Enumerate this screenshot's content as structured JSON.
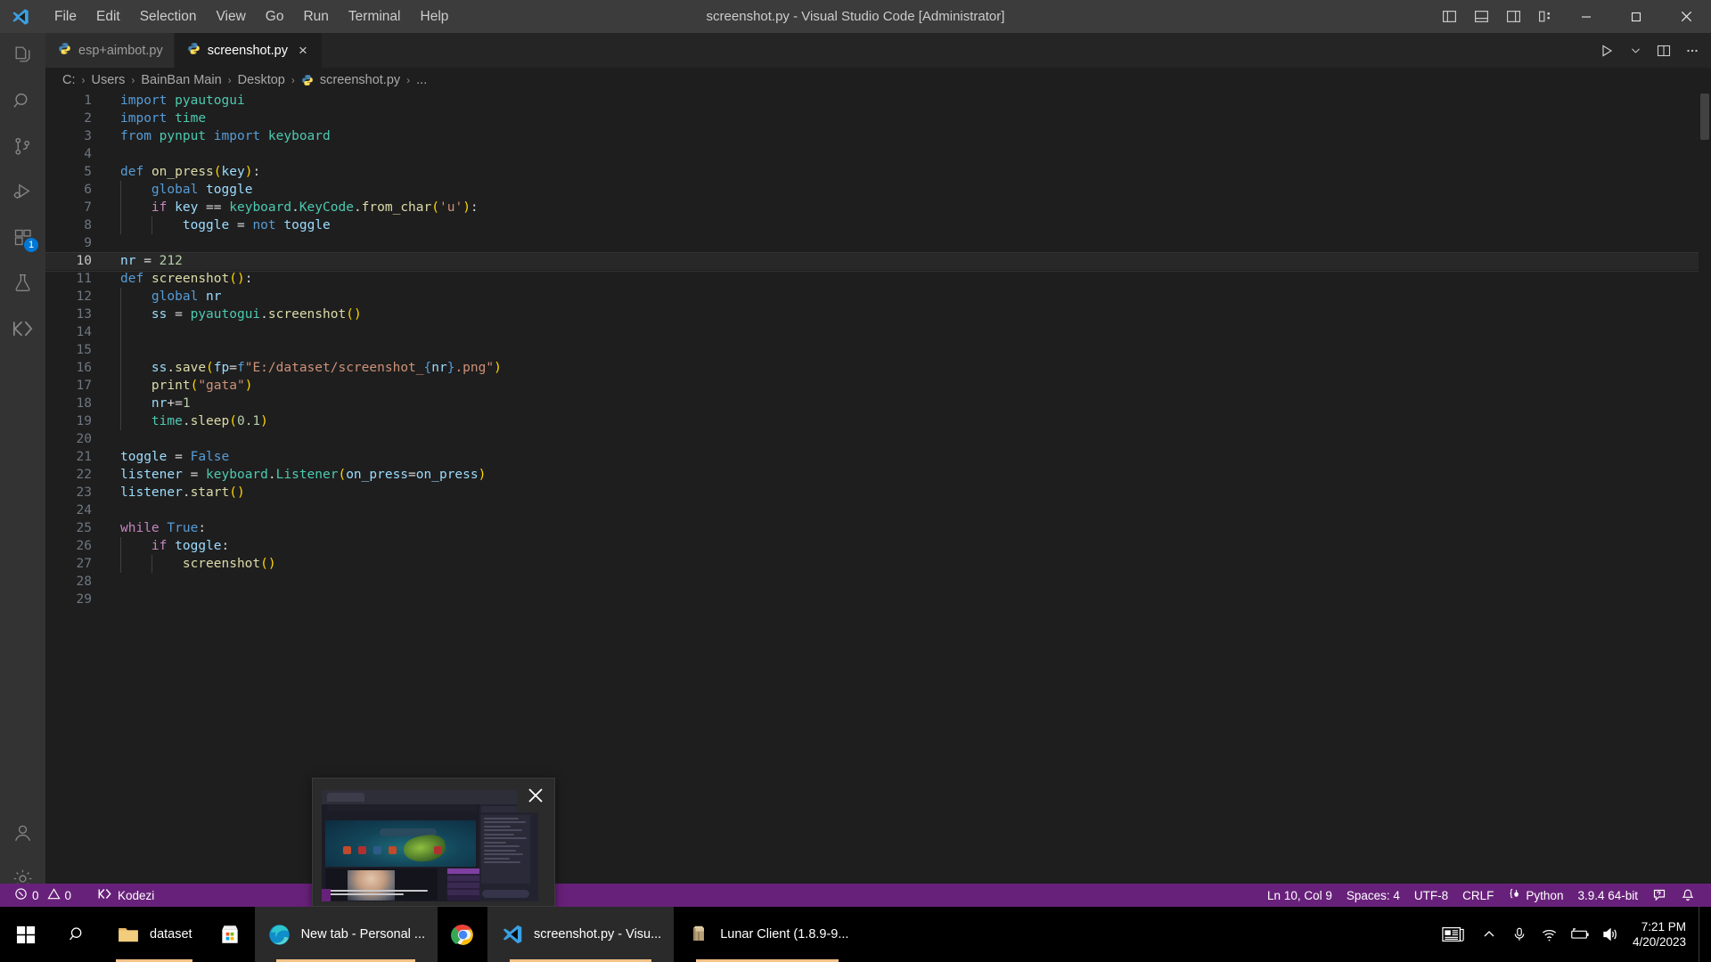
{
  "titlebar": {
    "window_title": "screenshot.py - Visual Studio Code [Administrator]",
    "logo": "vscode-logo",
    "menu": [
      "File",
      "Edit",
      "Selection",
      "View",
      "Go",
      "Run",
      "Terminal",
      "Help"
    ],
    "layout_buttons": [
      "toggle-primary-sidebar",
      "toggle-panel",
      "toggle-secondary-sidebar",
      "customize-layout"
    ],
    "window_controls": [
      "minimize",
      "maximize",
      "close"
    ]
  },
  "activitybar": {
    "items": [
      {
        "name": "explorer",
        "icon": "files-icon",
        "active": false
      },
      {
        "name": "search",
        "icon": "search-icon",
        "active": false
      },
      {
        "name": "source-control",
        "icon": "source-control-icon",
        "active": false
      },
      {
        "name": "run-and-debug",
        "icon": "run-debug-icon",
        "active": false
      },
      {
        "name": "extensions",
        "icon": "extensions-icon",
        "active": false,
        "badge": "1"
      },
      {
        "name": "testing",
        "icon": "beaker-icon",
        "active": false
      },
      {
        "name": "kodezi",
        "icon": "kodezi-icon",
        "active": false
      }
    ],
    "bottom": [
      {
        "name": "accounts",
        "icon": "account-icon"
      },
      {
        "name": "manage",
        "icon": "gear-icon"
      }
    ]
  },
  "tabs": [
    {
      "label": "esp+aimbot.py",
      "icon": "python-icon",
      "active": false,
      "closable": false
    },
    {
      "label": "screenshot.py",
      "icon": "python-icon",
      "active": true,
      "closable": true,
      "close_glyph": "×"
    }
  ],
  "tab_actions": [
    "run-python-file",
    "run-chevron",
    "split-editor",
    "more-actions"
  ],
  "breadcrumb": {
    "segments": [
      "C:",
      "Users",
      "BainBan Main",
      "Desktop",
      "screenshot.py",
      "..."
    ],
    "separator": "›",
    "file_icon": "python-icon"
  },
  "editor": {
    "language": "python",
    "lines": [
      {
        "n": 1,
        "tokens": [
          [
            "t-kw",
            "import"
          ],
          [
            "t-plain",
            " "
          ],
          [
            "t-cls",
            "pyautogui"
          ]
        ]
      },
      {
        "n": 2,
        "tokens": [
          [
            "t-kw",
            "import"
          ],
          [
            "t-plain",
            " "
          ],
          [
            "t-cls",
            "time"
          ]
        ]
      },
      {
        "n": 3,
        "tokens": [
          [
            "t-kw",
            "from"
          ],
          [
            "t-plain",
            " "
          ],
          [
            "t-cls",
            "pynput"
          ],
          [
            "t-plain",
            " "
          ],
          [
            "t-kw",
            "import"
          ],
          [
            "t-plain",
            " "
          ],
          [
            "t-cls",
            "keyboard"
          ]
        ]
      },
      {
        "n": 4,
        "tokens": []
      },
      {
        "n": 5,
        "tokens": [
          [
            "t-kw",
            "def"
          ],
          [
            "t-plain",
            " "
          ],
          [
            "t-fn",
            "on_press"
          ],
          [
            "t-paren",
            "("
          ],
          [
            "t-var",
            "key"
          ],
          [
            "t-paren",
            ")"
          ],
          [
            "t-plain",
            ":"
          ]
        ]
      },
      {
        "n": 6,
        "tokens": [
          [
            "t-plain",
            "    "
          ],
          [
            "t-kw",
            "global"
          ],
          [
            "t-plain",
            " "
          ],
          [
            "t-var",
            "toggle"
          ]
        ],
        "guides": [
          1
        ]
      },
      {
        "n": 7,
        "tokens": [
          [
            "t-plain",
            "    "
          ],
          [
            "t-kw2",
            "if"
          ],
          [
            "t-plain",
            " "
          ],
          [
            "t-var",
            "key"
          ],
          [
            "t-plain",
            " == "
          ],
          [
            "t-cls",
            "keyboard"
          ],
          [
            "t-plain",
            "."
          ],
          [
            "t-cls",
            "KeyCode"
          ],
          [
            "t-plain",
            "."
          ],
          [
            "t-fn",
            "from_char"
          ],
          [
            "t-paren",
            "("
          ],
          [
            "t-str",
            "'u'"
          ],
          [
            "t-paren",
            ")"
          ],
          [
            "t-plain",
            ":"
          ]
        ],
        "guides": [
          1
        ]
      },
      {
        "n": 8,
        "tokens": [
          [
            "t-plain",
            "        "
          ],
          [
            "t-var",
            "toggle"
          ],
          [
            "t-plain",
            " = "
          ],
          [
            "t-kw",
            "not"
          ],
          [
            "t-plain",
            " "
          ],
          [
            "t-var",
            "toggle"
          ]
        ],
        "guides": [
          1,
          2
        ]
      },
      {
        "n": 9,
        "tokens": []
      },
      {
        "n": 10,
        "tokens": [
          [
            "t-var",
            "nr"
          ],
          [
            "t-plain",
            " = "
          ],
          [
            "t-num",
            "212"
          ]
        ],
        "current": true
      },
      {
        "n": 11,
        "tokens": [
          [
            "t-kw",
            "def"
          ],
          [
            "t-plain",
            " "
          ],
          [
            "t-fn",
            "screenshot"
          ],
          [
            "t-paren",
            "("
          ],
          [
            "t-paren",
            ")"
          ],
          [
            "t-plain",
            ":"
          ]
        ]
      },
      {
        "n": 12,
        "tokens": [
          [
            "t-plain",
            "    "
          ],
          [
            "t-kw",
            "global"
          ],
          [
            "t-plain",
            " "
          ],
          [
            "t-var",
            "nr"
          ]
        ],
        "guides": [
          1
        ]
      },
      {
        "n": 13,
        "tokens": [
          [
            "t-plain",
            "    "
          ],
          [
            "t-var",
            "ss"
          ],
          [
            "t-plain",
            " = "
          ],
          [
            "t-cls",
            "pyautogui"
          ],
          [
            "t-plain",
            "."
          ],
          [
            "t-fn",
            "screenshot"
          ],
          [
            "t-paren",
            "("
          ],
          [
            "t-paren",
            ")"
          ]
        ],
        "guides": [
          1
        ]
      },
      {
        "n": 14,
        "tokens": [],
        "guides": [
          1
        ]
      },
      {
        "n": 15,
        "tokens": [],
        "guides": [
          1
        ]
      },
      {
        "n": 16,
        "tokens": [
          [
            "t-plain",
            "    "
          ],
          [
            "t-var",
            "ss"
          ],
          [
            "t-plain",
            "."
          ],
          [
            "t-fn",
            "save"
          ],
          [
            "t-paren",
            "("
          ],
          [
            "t-var",
            "fp"
          ],
          [
            "t-plain",
            "="
          ],
          [
            "t-fstr",
            "f"
          ],
          [
            "t-str",
            "\"E:/dataset/screenshot_"
          ],
          [
            "t-brace",
            "{"
          ],
          [
            "t-var",
            "nr"
          ],
          [
            "t-brace",
            "}"
          ],
          [
            "t-str",
            ".png\""
          ],
          [
            "t-paren",
            ")"
          ]
        ],
        "guides": [
          1
        ]
      },
      {
        "n": 17,
        "tokens": [
          [
            "t-plain",
            "    "
          ],
          [
            "t-fn",
            "print"
          ],
          [
            "t-paren",
            "("
          ],
          [
            "t-str",
            "\"gata\""
          ],
          [
            "t-paren",
            ")"
          ]
        ],
        "guides": [
          1
        ]
      },
      {
        "n": 18,
        "tokens": [
          [
            "t-plain",
            "    "
          ],
          [
            "t-var",
            "nr"
          ],
          [
            "t-plain",
            "+="
          ],
          [
            "t-num",
            "1"
          ]
        ],
        "guides": [
          1
        ]
      },
      {
        "n": 19,
        "tokens": [
          [
            "t-plain",
            "    "
          ],
          [
            "t-cls",
            "time"
          ],
          [
            "t-plain",
            "."
          ],
          [
            "t-fn",
            "sleep"
          ],
          [
            "t-paren",
            "("
          ],
          [
            "t-num",
            "0.1"
          ],
          [
            "t-paren",
            ")"
          ]
        ],
        "guides": [
          1
        ]
      },
      {
        "n": 20,
        "tokens": []
      },
      {
        "n": 21,
        "tokens": [
          [
            "t-var",
            "toggle"
          ],
          [
            "t-plain",
            " = "
          ],
          [
            "t-kw",
            "False"
          ]
        ]
      },
      {
        "n": 22,
        "tokens": [
          [
            "t-var",
            "listener"
          ],
          [
            "t-plain",
            " = "
          ],
          [
            "t-cls",
            "keyboard"
          ],
          [
            "t-plain",
            "."
          ],
          [
            "t-cls",
            "Listener"
          ],
          [
            "t-paren",
            "("
          ],
          [
            "t-var",
            "on_press"
          ],
          [
            "t-plain",
            "="
          ],
          [
            "t-var",
            "on_press"
          ],
          [
            "t-paren",
            ")"
          ]
        ]
      },
      {
        "n": 23,
        "tokens": [
          [
            "t-var",
            "listener"
          ],
          [
            "t-plain",
            "."
          ],
          [
            "t-fn",
            "start"
          ],
          [
            "t-paren",
            "("
          ],
          [
            "t-paren",
            ")"
          ]
        ]
      },
      {
        "n": 24,
        "tokens": []
      },
      {
        "n": 25,
        "tokens": [
          [
            "t-kw2",
            "while"
          ],
          [
            "t-plain",
            " "
          ],
          [
            "t-kw",
            "True"
          ],
          [
            "t-plain",
            ":"
          ]
        ]
      },
      {
        "n": 26,
        "tokens": [
          [
            "t-plain",
            "    "
          ],
          [
            "t-kw2",
            "if"
          ],
          [
            "t-plain",
            " "
          ],
          [
            "t-var",
            "toggle"
          ],
          [
            "t-plain",
            ":"
          ]
        ],
        "guides": [
          1
        ]
      },
      {
        "n": 27,
        "tokens": [
          [
            "t-plain",
            "        "
          ],
          [
            "t-fn",
            "screenshot"
          ],
          [
            "t-paren",
            "("
          ],
          [
            "t-paren",
            ")"
          ]
        ],
        "guides": [
          1,
          2
        ]
      },
      {
        "n": 28,
        "tokens": []
      },
      {
        "n": 29,
        "tokens": []
      }
    ]
  },
  "statusbar": {
    "background": "#68217a",
    "left": [
      {
        "name": "problems",
        "icon": "error-icon",
        "errors": "0",
        "warn_icon": "warning-icon",
        "warnings": "0"
      },
      {
        "name": "kodezi",
        "icon": "kodezi-icon",
        "label": "Kodezi"
      }
    ],
    "right": [
      {
        "name": "cursor-position",
        "label": "Ln 10, Col 9"
      },
      {
        "name": "indentation",
        "label": "Spaces: 4"
      },
      {
        "name": "encoding",
        "label": "UTF-8"
      },
      {
        "name": "eol",
        "label": "CRLF"
      },
      {
        "name": "language-mode",
        "label": "Python",
        "icon": "python-brackets-icon"
      },
      {
        "name": "interpreter",
        "label": "3.9.4 64-bit"
      },
      {
        "name": "feedback",
        "icon": "feedback-icon"
      },
      {
        "name": "notifications",
        "icon": "bell-icon"
      }
    ]
  },
  "preview": {
    "name": "taskbar-thumbnail-preview",
    "close_glyph": "✕"
  },
  "taskbar": {
    "start": "windows-start-icon",
    "search": "search-icon",
    "apps": [
      {
        "label": "dataset",
        "icon": "folder-icon",
        "running": true,
        "active": false
      },
      {
        "label": "",
        "icon": "microsoft-store-icon",
        "running": false,
        "active": false
      },
      {
        "label": "New tab - Personal ...",
        "icon": "edge-icon",
        "running": true,
        "active": true
      },
      {
        "label": "",
        "icon": "chrome-icon",
        "running": false,
        "active": false
      },
      {
        "label": "screenshot.py - Visu...",
        "icon": "vscode-icon",
        "running": true,
        "active": true
      },
      {
        "label": "Lunar Client (1.8.9-9...",
        "icon": "lunar-client-icon",
        "running": true,
        "active": false
      }
    ],
    "tray": [
      {
        "name": "news-and-interests",
        "icon": "news-icon"
      },
      {
        "name": "show-hidden-icons",
        "icon": "chevron-up-icon"
      },
      {
        "name": "microphone",
        "icon": "microphone-icon"
      },
      {
        "name": "network",
        "icon": "wifi-icon"
      },
      {
        "name": "battery",
        "icon": "battery-icon"
      },
      {
        "name": "volume",
        "icon": "speaker-icon"
      }
    ],
    "clock": {
      "time": "7:21 PM",
      "date": "4/20/2023"
    }
  }
}
